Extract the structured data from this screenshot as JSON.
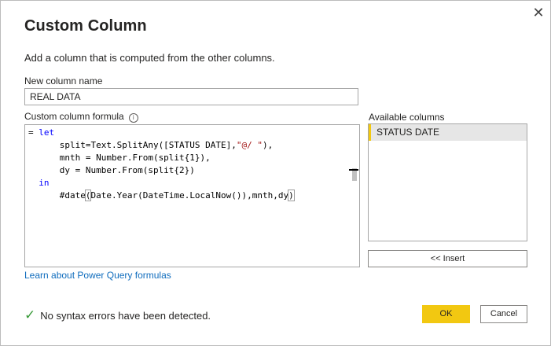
{
  "dialog": {
    "title": "Custom Column",
    "subtitle": "Add a column that is computed from the other columns.",
    "close_icon": "close-icon"
  },
  "new_column": {
    "label": "New column name",
    "value": "REAL DATA"
  },
  "formula": {
    "label": "Custom column formula",
    "info_icon": "info-icon",
    "lines": [
      "= let",
      "      split=Text.SplitAny([STATUS DATE],\"@/ \"),",
      "      mnth = Number.From(split{1}),",
      "      dy = Number.From(split{2})",
      "  in",
      "      #date(Date.Year(DateTime.LocalNow()),mnth,dy)"
    ]
  },
  "available_columns": {
    "label": "Available columns",
    "items": [
      "STATUS DATE"
    ],
    "insert_label": "<< Insert"
  },
  "learn_link": "Learn about Power Query formulas",
  "status": {
    "icon": "check-icon",
    "text": "No syntax errors have been detected."
  },
  "buttons": {
    "ok": "OK",
    "cancel": "Cancel"
  },
  "colors": {
    "accent": "#f2c811",
    "link": "#0f6cbd",
    "keyword": "#0000ff",
    "string": "#a31515",
    "success": "#3a9b3a"
  }
}
